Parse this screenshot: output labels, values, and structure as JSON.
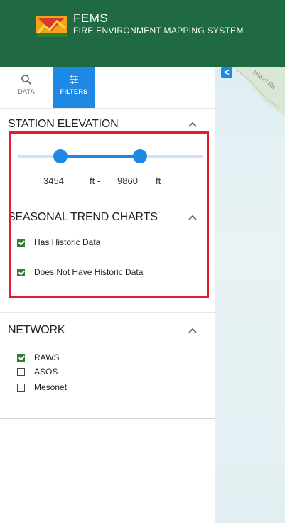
{
  "header": {
    "app_short": "FEMS",
    "app_full": "FIRE ENVIRONMENT MAPPING SYSTEM",
    "color": "#1f6a42"
  },
  "tabs": [
    {
      "label": "DATA",
      "icon": "search-icon"
    },
    {
      "label": "FILTERS",
      "icon": "sliders-icon",
      "active": true
    }
  ],
  "elevation": {
    "title": "STATION ELEVATION",
    "min": "3454",
    "max": "9860",
    "unit_sep": "ft -",
    "unit": "ft"
  },
  "seasonal": {
    "title": "SEASONAL TREND CHARTS",
    "options": [
      {
        "label": "Has Historic Data",
        "checked": true
      },
      {
        "label": "Does Not Have Historic Data",
        "checked": true
      }
    ]
  },
  "network": {
    "title": "NETWORK",
    "options": [
      {
        "label": "RAWS",
        "checked": true
      },
      {
        "label": "ASOS",
        "checked": false
      },
      {
        "label": "Mesonet",
        "checked": false
      }
    ]
  },
  "map": {
    "label": "Island Ra",
    "collapse_glyph": "<"
  },
  "colors": {
    "accent": "#1e88e5",
    "check": "#2e7d32",
    "highlight": "#e41c2a"
  }
}
